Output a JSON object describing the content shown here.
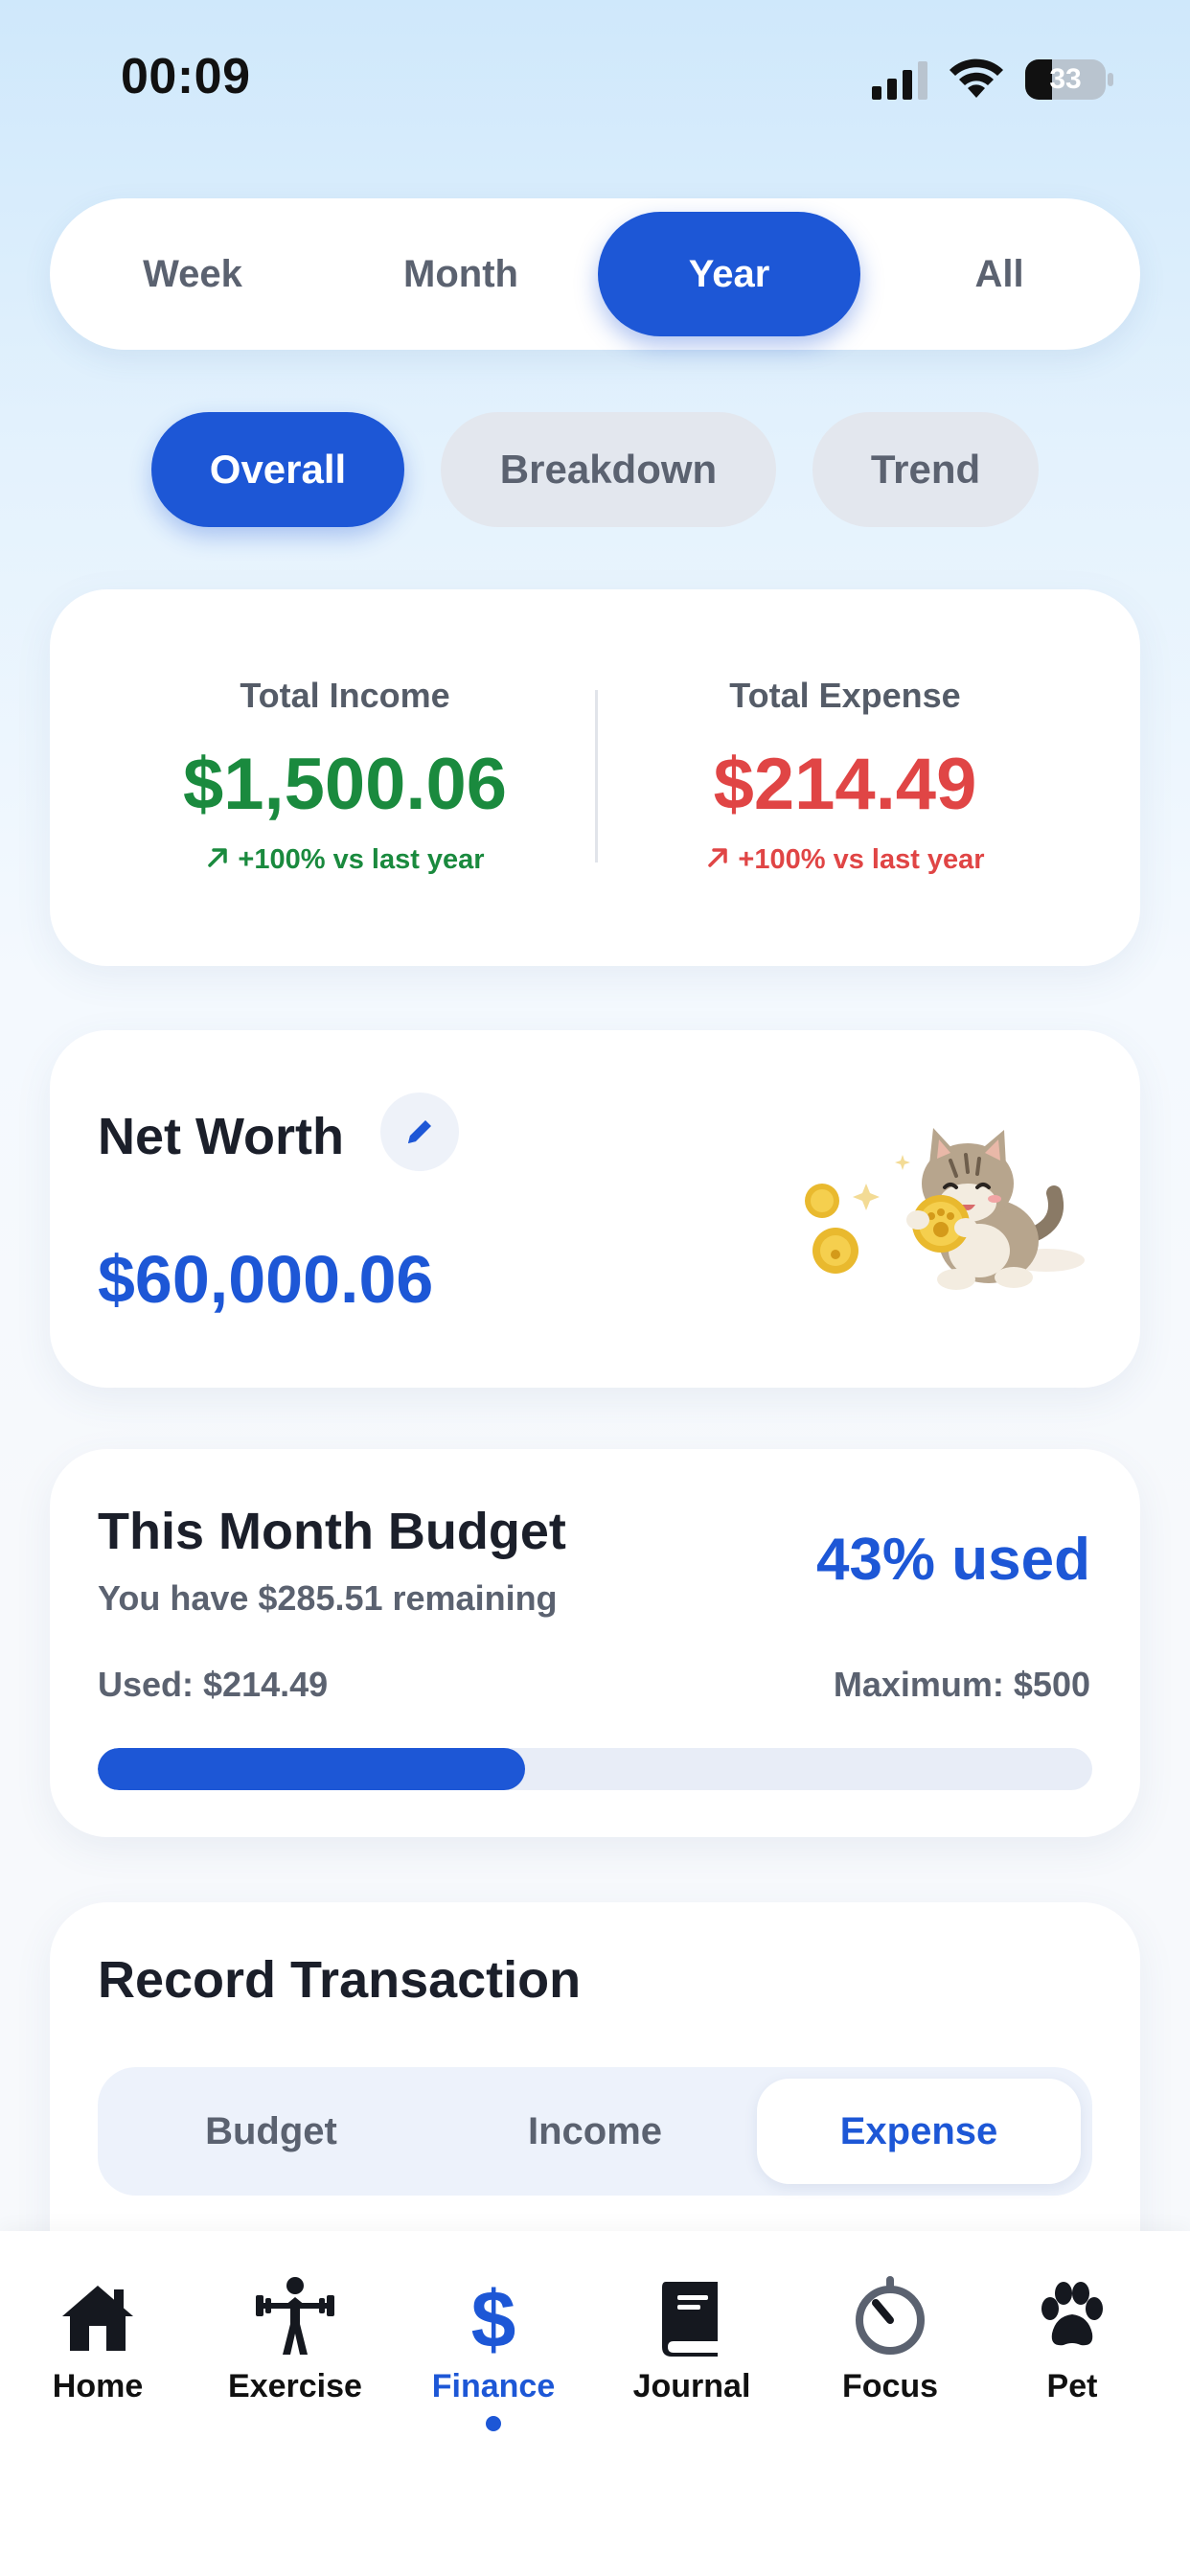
{
  "status_bar": {
    "time": "00:09",
    "battery": "33",
    "battery_fraction": 0.33
  },
  "period_tabs": [
    {
      "label": "Week",
      "active": false
    },
    {
      "label": "Month",
      "active": false
    },
    {
      "label": "Year",
      "active": true
    },
    {
      "label": "All",
      "active": false
    }
  ],
  "view_tabs": [
    {
      "label": "Overall",
      "active": true
    },
    {
      "label": "Breakdown",
      "active": false
    },
    {
      "label": "Trend",
      "active": false
    }
  ],
  "summary": {
    "income": {
      "label": "Total Income",
      "amount": "$1,500.06",
      "change": "+100% vs last year"
    },
    "expense": {
      "label": "Total Expense",
      "amount": "$214.49",
      "change": "+100% vs last year"
    }
  },
  "net_worth": {
    "title": "Net Worth",
    "amount": "$60,000.06",
    "mascot": "cat-with-coins"
  },
  "budget": {
    "title": "This Month Budget",
    "remaining": "You have $285.51 remaining",
    "percent_label": "43% used",
    "used": "Used: $214.49",
    "maximum": "Maximum: $500",
    "used_fraction": 0.43
  },
  "record": {
    "title": "Record Transaction",
    "tabs": [
      {
        "label": "Budget",
        "active": false
      },
      {
        "label": "Income",
        "active": false
      },
      {
        "label": "Expense",
        "active": true
      }
    ]
  },
  "nav": [
    {
      "label": "Home",
      "icon": "home-icon",
      "active": false
    },
    {
      "label": "Exercise",
      "icon": "weightlifter-icon",
      "active": false
    },
    {
      "label": "Finance",
      "icon": "dollar-icon",
      "active": true
    },
    {
      "label": "Journal",
      "icon": "book-icon",
      "active": false
    },
    {
      "label": "Focus",
      "icon": "timer-icon",
      "active": false
    },
    {
      "label": "Pet",
      "icon": "paw-icon",
      "active": false
    }
  ],
  "colors": {
    "accent": "#1d57d6",
    "income": "#1a8a3e",
    "expense": "#e04545",
    "track": "#e8edf7"
  }
}
